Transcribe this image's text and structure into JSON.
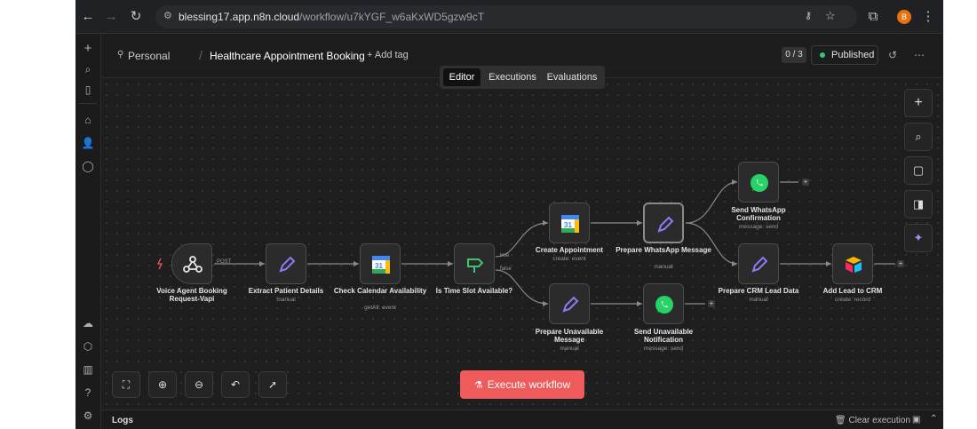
{
  "browser": {
    "url_host": "blessing17.app.n8n.cloud",
    "url_path": "/workflow/u7kYGF_w6aKxWD5gzw9cT",
    "profile_initial": "B"
  },
  "header": {
    "personal_label": "Personal",
    "separator": "/",
    "workflow_title": "Healthcare Appointment Booking",
    "add_tag_label": "+ Add tag",
    "counter": "0 / 3",
    "published_label": "Published"
  },
  "tabs": [
    {
      "label": "Editor",
      "active": true
    },
    {
      "label": "Executions",
      "active": false
    },
    {
      "label": "Evaluations",
      "active": false
    }
  ],
  "nodes": [
    {
      "id": "trigger",
      "title": "Voice Agent Booking Request-Vapi",
      "subtitle": "",
      "icon": "webhook-icon"
    },
    {
      "id": "extract",
      "title": "Extract Patient Details",
      "subtitle": "manual",
      "icon": "pen-icon"
    },
    {
      "id": "check",
      "title": "Check Calendar Availability",
      "subtitle": "getAll: event",
      "icon": "google-calendar-icon"
    },
    {
      "id": "if",
      "title": "Is Time Slot Available?",
      "subtitle": "",
      "icon": "signpost-icon"
    },
    {
      "id": "create",
      "title": "Create Appointment",
      "subtitle": "create: event",
      "icon": "google-calendar-icon"
    },
    {
      "id": "prepw",
      "title": "Prepare WhatsApp Message",
      "subtitle": "manual",
      "icon": "pen-icon"
    },
    {
      "id": "sendconf",
      "title": "Send WhatsApp Confirmation",
      "subtitle": "message: send",
      "icon": "whatsapp-icon"
    },
    {
      "id": "prepcrm",
      "title": "Prepare CRM Lead Data",
      "subtitle": "manual",
      "icon": "pen-icon"
    },
    {
      "id": "addcrm",
      "title": "Add Lead to CRM",
      "subtitle": "create: record",
      "icon": "airtable-icon"
    },
    {
      "id": "prepu",
      "title": "Prepare Unavailable Message",
      "subtitle": "manual",
      "icon": "pen-icon"
    },
    {
      "id": "sendu",
      "title": "Send Unavailable Notification",
      "subtitle": "message: send",
      "icon": "whatsapp-icon"
    }
  ],
  "edge_labels": {
    "post": "POST",
    "true": "true",
    "false": "false"
  },
  "execute_label": "Execute workflow",
  "logs": {
    "label": "Logs",
    "clear_label": "Clear execution"
  },
  "colors": {
    "accent": "#ef5a5a",
    "published_dot": "#3ec46d",
    "pen": "#8b7cf6",
    "whatsapp": "#25d366"
  }
}
